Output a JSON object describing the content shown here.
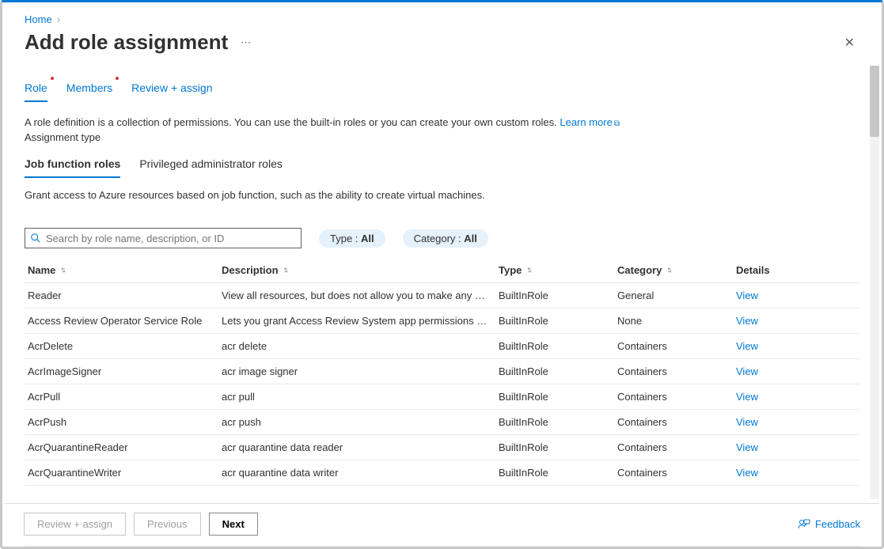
{
  "breadcrumb": {
    "home": "Home"
  },
  "title": "Add role assignment",
  "main_tabs": [
    {
      "label": "Role",
      "active": true,
      "has_dot": true
    },
    {
      "label": "Members",
      "active": false,
      "has_dot": true
    },
    {
      "label": "Review + assign",
      "active": false,
      "has_dot": false
    }
  ],
  "helper": {
    "text": "A role definition is a collection of permissions. You can use the built-in roles or you can create your own custom roles. ",
    "link": "Learn more"
  },
  "assignment_type_label": "Assignment type",
  "sub_tabs": [
    {
      "label": "Job function roles",
      "active": true
    },
    {
      "label": "Privileged administrator roles",
      "active": false
    }
  ],
  "sub_desc": "Grant access to Azure resources based on job function, such as the ability to create virtual machines.",
  "search": {
    "placeholder": "Search by role name, description, or ID"
  },
  "filters": {
    "type_label": "Type : ",
    "type_value": "All",
    "cat_label": "Category : ",
    "cat_value": "All"
  },
  "columns": {
    "name": "Name",
    "description": "Description",
    "type": "Type",
    "category": "Category",
    "details": "Details"
  },
  "view_label": "View",
  "rows": [
    {
      "name": "Reader",
      "description": "View all resources, but does not allow you to make any ch…",
      "type": "BuiltInRole",
      "category": "General"
    },
    {
      "name": "Access Review Operator Service Role",
      "description": "Lets you grant Access Review System app permissions to …",
      "type": "BuiltInRole",
      "category": "None"
    },
    {
      "name": "AcrDelete",
      "description": "acr delete",
      "type": "BuiltInRole",
      "category": "Containers"
    },
    {
      "name": "AcrImageSigner",
      "description": "acr image signer",
      "type": "BuiltInRole",
      "category": "Containers"
    },
    {
      "name": "AcrPull",
      "description": "acr pull",
      "type": "BuiltInRole",
      "category": "Containers"
    },
    {
      "name": "AcrPush",
      "description": "acr push",
      "type": "BuiltInRole",
      "category": "Containers"
    },
    {
      "name": "AcrQuarantineReader",
      "description": "acr quarantine data reader",
      "type": "BuiltInRole",
      "category": "Containers"
    },
    {
      "name": "AcrQuarantineWriter",
      "description": "acr quarantine data writer",
      "type": "BuiltInRole",
      "category": "Containers"
    }
  ],
  "footer": {
    "review": "Review + assign",
    "previous": "Previous",
    "next": "Next",
    "feedback": "Feedback"
  }
}
